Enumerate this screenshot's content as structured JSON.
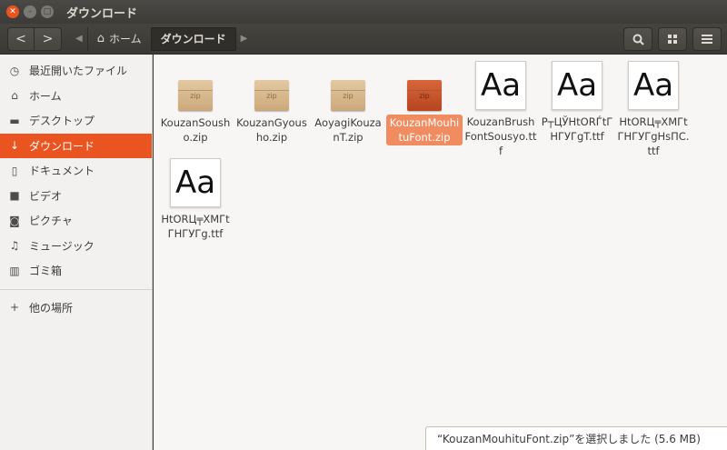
{
  "window": {
    "title": "ダウンロード"
  },
  "toolbar": {
    "back_icon": "<",
    "forward_icon": ">",
    "path": [
      {
        "label": "ホーム",
        "icon": "home-icon"
      },
      {
        "label": "ダウンロード"
      }
    ]
  },
  "sidebar": {
    "items": [
      {
        "label": "最近開いたファイル",
        "icon": "clock-icon"
      },
      {
        "label": "ホーム",
        "icon": "home-icon"
      },
      {
        "label": "デスクトップ",
        "icon": "folder-icon"
      },
      {
        "label": "ダウンロード",
        "icon": "download-icon",
        "active": true
      },
      {
        "label": "ドキュメント",
        "icon": "document-icon"
      },
      {
        "label": "ビデオ",
        "icon": "video-icon"
      },
      {
        "label": "ピクチャ",
        "icon": "camera-icon"
      },
      {
        "label": "ミュージック",
        "icon": "music-icon"
      },
      {
        "label": "ゴミ箱",
        "icon": "trash-icon"
      }
    ],
    "other": {
      "label": "他の場所",
      "icon": "plus-icon"
    }
  },
  "files": [
    {
      "name": "KouzanSousho.zip",
      "type": "zip",
      "icon_label": "zip"
    },
    {
      "name": "KouzanGyousho.zip",
      "type": "zip",
      "icon_label": "zip"
    },
    {
      "name": "AoyagiKouzanT.zip",
      "type": "zip",
      "icon_label": "zip"
    },
    {
      "name": "KouzanMouhituFont.zip",
      "type": "zip",
      "icon_label": "zip",
      "selected": true
    },
    {
      "name": "KouzanBrushFontSousyo.ttf",
      "type": "font",
      "icon_label": "Aa"
    },
    {
      "name": "Р┬ЦЎНtORЃtГНГУГgT.ttf",
      "type": "font",
      "icon_label": "Aa"
    },
    {
      "name": "HtORЦ╤XMГtГНГУГgHsПС.ttf",
      "type": "font",
      "icon_label": "Aa"
    },
    {
      "name": "HtORЦ╤XMГtГНГУГg.ttf",
      "type": "font",
      "icon_label": "Aa"
    }
  ],
  "status": {
    "text": "“KouzanMouhituFont.zip”を選択しました (5.6 MB)"
  },
  "colors": {
    "accent": "#e95420",
    "selection": "#f08c60"
  }
}
